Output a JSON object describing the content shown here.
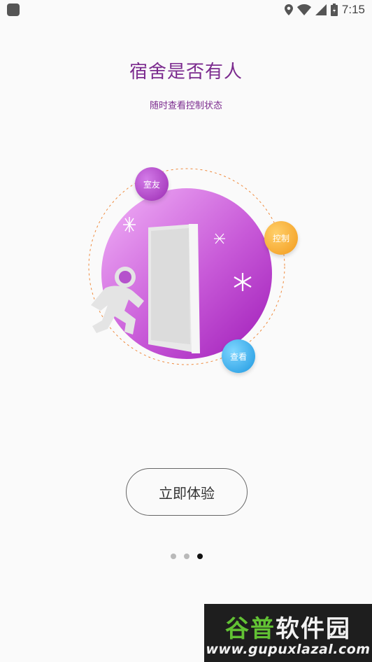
{
  "status_bar": {
    "time": "7:15",
    "icons": [
      "location-icon",
      "wifi-icon",
      "signal-icon",
      "battery-charging-icon"
    ]
  },
  "intro": {
    "title": "宿舍是否有人",
    "subtitle": "随时查看控制状态"
  },
  "illustration": {
    "bubbles": {
      "roommate": "室友",
      "control": "控制",
      "view": "查看"
    },
    "colors": {
      "circle_start": "#f0b0f6",
      "circle_end": "#a51fbe",
      "bubble_purple": "#a63bc2",
      "bubble_orange": "#f4a52a",
      "bubble_blue": "#2aa3e7",
      "dashed_ring": "#ef8a3d"
    }
  },
  "actions": {
    "start_label": "立即体验"
  },
  "pager": {
    "count": 3,
    "active_index": 2
  },
  "watermark": {
    "title_green": "谷普",
    "title_white": "软件园",
    "url": "www.gupuxlazal.com"
  }
}
